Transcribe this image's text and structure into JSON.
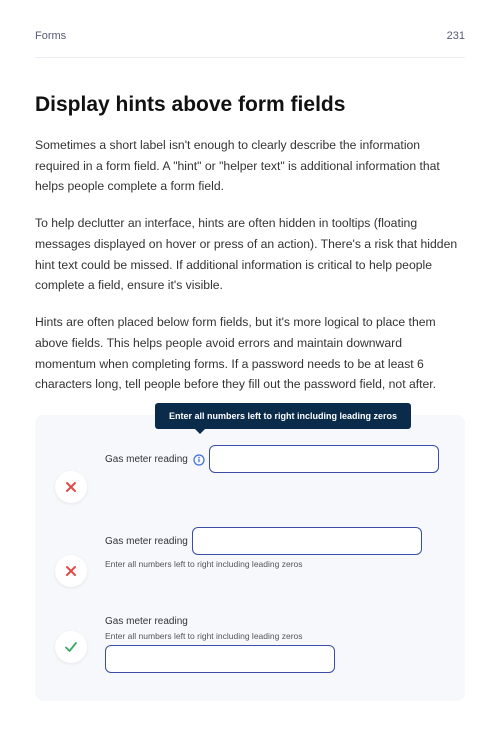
{
  "header": {
    "section": "Forms",
    "page": "231"
  },
  "heading": "Display hints above form fields",
  "paras": [
    "Sometimes a short label isn't enough to clearly describe the information required in a form field. A \"hint\" or \"helper text\" is additional information that helps people complete a form field.",
    "To help declutter an interface, hints are often hidden in tooltips (floating messages displayed on hover or press of an action). There's a risk that hidden hint text could be missed. If additional information is critical to help people complete a field, ensure it's visible.",
    "Hints are often placed below form fields, but it's more logical to place them above fields. This helps people avoid errors and maintain downward momentum when completing forms. If a password needs to be at least 6 characters long, tell people before they fill out the password field, not after."
  ],
  "example": {
    "tooltip": "Enter all numbers left to right including leading zeros",
    "label": "Gas meter reading",
    "helper": "Enter all numbers left to right including leading zeros"
  }
}
